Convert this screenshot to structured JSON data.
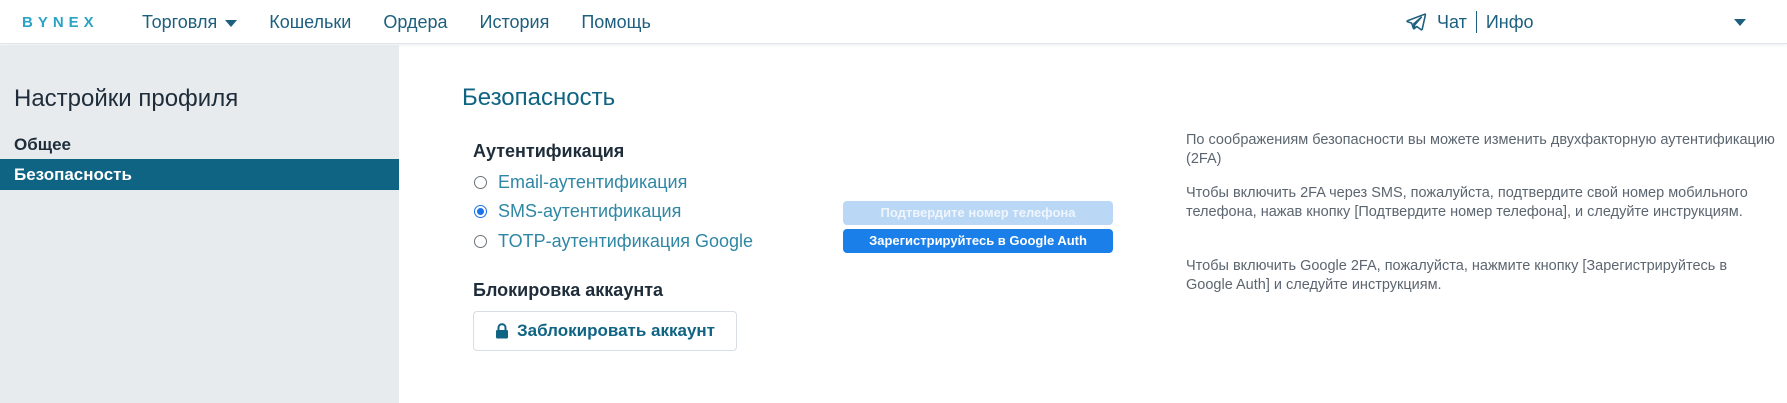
{
  "header": {
    "logo": "BYNEX",
    "nav": [
      {
        "label": "Торговля",
        "has_dropdown": true
      },
      {
        "label": "Кошельки"
      },
      {
        "label": "Ордера"
      },
      {
        "label": "История"
      },
      {
        "label": "Помощь"
      }
    ],
    "chat_label": "Чат",
    "info_label": "Инфо",
    "chat_icon": "telegram-icon",
    "user_menu_icon": "chevron-down-icon"
  },
  "sidebar": {
    "title": "Настройки профиля",
    "items": [
      {
        "label": "Общее",
        "active": false
      },
      {
        "label": "Безопасность",
        "active": true
      }
    ]
  },
  "main": {
    "section_title": "Безопасность",
    "auth": {
      "heading": "Аутентификация",
      "options": [
        {
          "label": "Email-аутентификация",
          "selected": false
        },
        {
          "label": "SMS-аутентификация",
          "selected": true
        },
        {
          "label": "TOTP-аутентификация Google",
          "selected": false
        }
      ],
      "verify_phone_button": "Подтвердите номер телефона",
      "google_auth_button": "Зарегистрируйтесь в Google Auth"
    },
    "lock": {
      "heading": "Блокировка аккаунта",
      "button_label": "Заблокировать аккаунт",
      "button_icon": "lock-icon"
    },
    "info": [
      "По соображениям безопасности вы можете изменить двухфакторную аутентификацию (2FA)",
      "Чтобы включить 2FA через SMS, пожалуйста, подтвердите свой номер мобильного телефона, нажав кнопку [Подтвердите номер телефона], и следуйте инструкциям.",
      "Чтобы включить Google 2FA, пожалуйста, нажмите кнопку [Зарегистрируйтесь в Google Auth] и следуйте инструкциям."
    ]
  },
  "colors": {
    "brand": "#2aa3c4",
    "nav_text": "#1c5f7e",
    "active_sidebar": "#0f6383",
    "primary_button": "#1a7fe8",
    "disabled_button": "#bad7f5"
  }
}
